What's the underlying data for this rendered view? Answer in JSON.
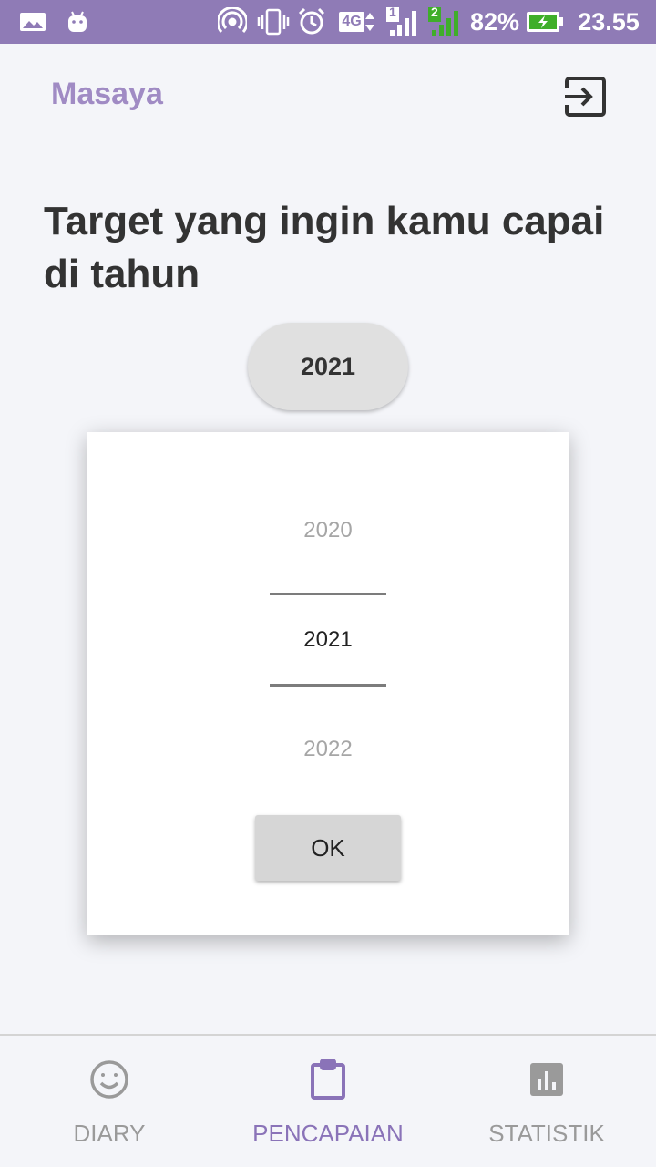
{
  "status_bar": {
    "battery_percent": "82%",
    "time": "23.55",
    "network_type": "4G",
    "sim1_label": "1",
    "sim2_label": "2",
    "icons": [
      "gallery-icon",
      "android-icon",
      "hotspot-icon",
      "vibrate-icon",
      "alarm-icon",
      "network-4g-icon",
      "signal-sim1-icon",
      "signal-sim2-icon",
      "battery-charging-icon"
    ]
  },
  "app_bar": {
    "title": "Masaya",
    "logout_icon": "exit-icon"
  },
  "headline": "Target yang ingin kamu capai di tahun",
  "selected_year": "2021",
  "year_picker": {
    "previous": "2020",
    "current": "2021",
    "next": "2022",
    "ok_label": "OK"
  },
  "bottom_nav": {
    "items": [
      {
        "label": "DIARY",
        "icon": "smiley-icon",
        "active": false
      },
      {
        "label": "PENCAPAIAN",
        "icon": "clipboard-icon",
        "active": true
      },
      {
        "label": "STATISTIK",
        "icon": "bar-chart-icon",
        "active": false
      }
    ]
  },
  "colors": {
    "status_bar": "#8f7bb6",
    "accent": "#a08bc4",
    "active_nav": "#8a73b8",
    "inactive_nav": "#9a9a9a",
    "background": "#f4f5f9"
  }
}
